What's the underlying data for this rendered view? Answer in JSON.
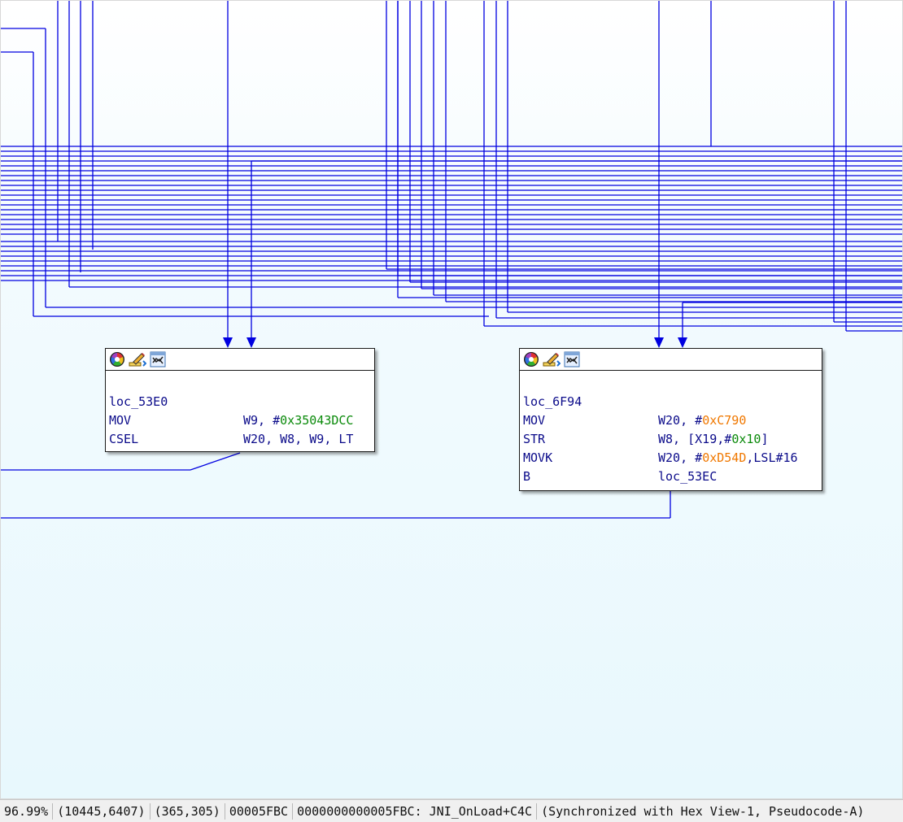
{
  "graph": {
    "node_left": {
      "label": "loc_53E0",
      "lines": [
        {
          "mnemonic": "MOV",
          "operand_pre": "W9, #",
          "imm": "0x35043DCC",
          "operand_post": "",
          "imm_color": "#0a8a0a"
        },
        {
          "mnemonic": "CSEL",
          "operand_pre": "W20, W8, W9, LT",
          "imm": "",
          "operand_post": "",
          "imm_color": ""
        }
      ]
    },
    "node_right": {
      "label": "loc_6F94",
      "lines": [
        {
          "mnemonic": "MOV",
          "operand_pre": "W20, #",
          "imm": "0xC790",
          "operand_post": "",
          "imm_color": "#f07800"
        },
        {
          "mnemonic": "STR",
          "operand_pre": "W8, [X19,#",
          "imm": "0x10",
          "operand_post": "]",
          "imm_color": "#0a8a0a"
        },
        {
          "mnemonic": "MOVK",
          "operand_pre": "W20, #",
          "imm": "0xD54D",
          "operand_post": ",LSL#16",
          "imm_color": "#f07800"
        },
        {
          "mnemonic": "B",
          "operand_pre": "loc_53EC",
          "imm": "",
          "operand_post": "",
          "imm_color": ""
        }
      ]
    },
    "header_icons": [
      "color-palette-icon",
      "rename-pencil-icon",
      "graph-xref-icon"
    ],
    "edge_color": "#0000e0"
  },
  "statusbar": {
    "zoom": "96.99%",
    "graph_coords": "(10445,6407)",
    "mouse_coords": "(365,305)",
    "offset": "00005FBC",
    "address": "0000000000005FBC: JNI_OnLoad+C4C",
    "sync": "(Synchronized with Hex View-1, Pseudocode-A)"
  }
}
